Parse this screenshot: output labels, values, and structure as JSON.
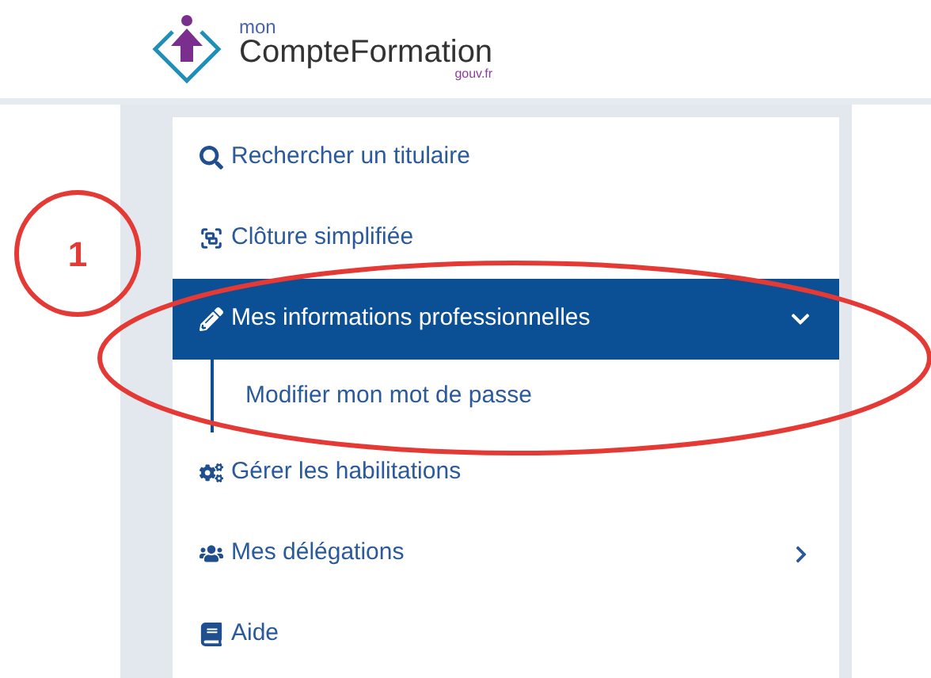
{
  "logo": {
    "prefix": "mon",
    "name": "CompteFormation",
    "suffix": "gouv.fr"
  },
  "menu": [
    {
      "label": "Rechercher un titulaire",
      "selected": false
    },
    {
      "label": "Clôture simplifiée",
      "selected": false
    },
    {
      "label": "Mes informations professionnelles",
      "selected": true,
      "expanded": true,
      "children": [
        {
          "label": "Modifier mon mot de passe"
        }
      ]
    },
    {
      "label": "Gérer les habilitations",
      "selected": false
    },
    {
      "label": "Mes délégations",
      "selected": false,
      "expanded": false
    },
    {
      "label": "Aide",
      "selected": false
    }
  ],
  "callout": {
    "number": "1"
  }
}
